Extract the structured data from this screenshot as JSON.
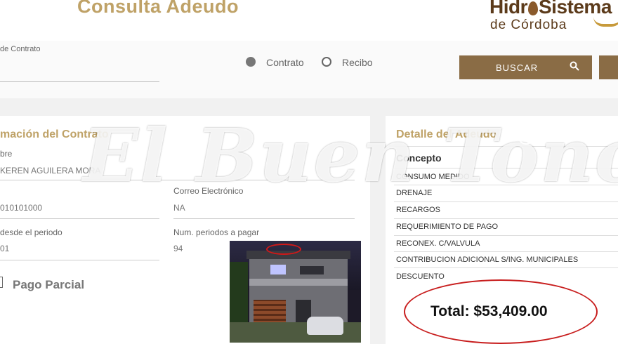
{
  "header": {
    "title": "Consulta Adeudo",
    "logo_line1_a": "Hidr",
    "logo_line1_b": "Sistema",
    "logo_line2": "de Córdoba"
  },
  "search": {
    "field_label": "de Contrato",
    "radio_contrato": "Contrato",
    "radio_recibo": "Recibo",
    "buscar_label": "BUSCAR"
  },
  "contract_info": {
    "title": "mación del Contrato",
    "nombre_label": "bre",
    "nombre_value": "KEREN AGUILERA MORA",
    "numero_value": "010101000",
    "correo_label": "Correo Electrónico",
    "correo_value": "NA",
    "desde_label": "desde el periodo",
    "desde_value": "01",
    "num_periodos_label": "Num. periodos a pagar",
    "num_periodos_value": "94",
    "pago_parcial_label": "Pago Parcial"
  },
  "debt_detail": {
    "title": "Detalle del Adeudo",
    "concepto_header": "Concepto",
    "items": [
      "CONSUMO MEDIDO",
      "DRENAJE",
      "RECARGOS",
      "REQUERIMIENTO DE PAGO",
      "RECONEX. C/VALVULA",
      "CONTRIBUCION ADICIONAL S/ING. MUNICIPALES",
      "DESCUENTO"
    ],
    "total": "Total: $53,409.00"
  },
  "watermark": {
    "text": "El Buen Tono",
    "registered": "®"
  },
  "colors": {
    "gold": "#bfa267",
    "button": "#8a6c45",
    "annotation_red": "#c81e1e"
  }
}
